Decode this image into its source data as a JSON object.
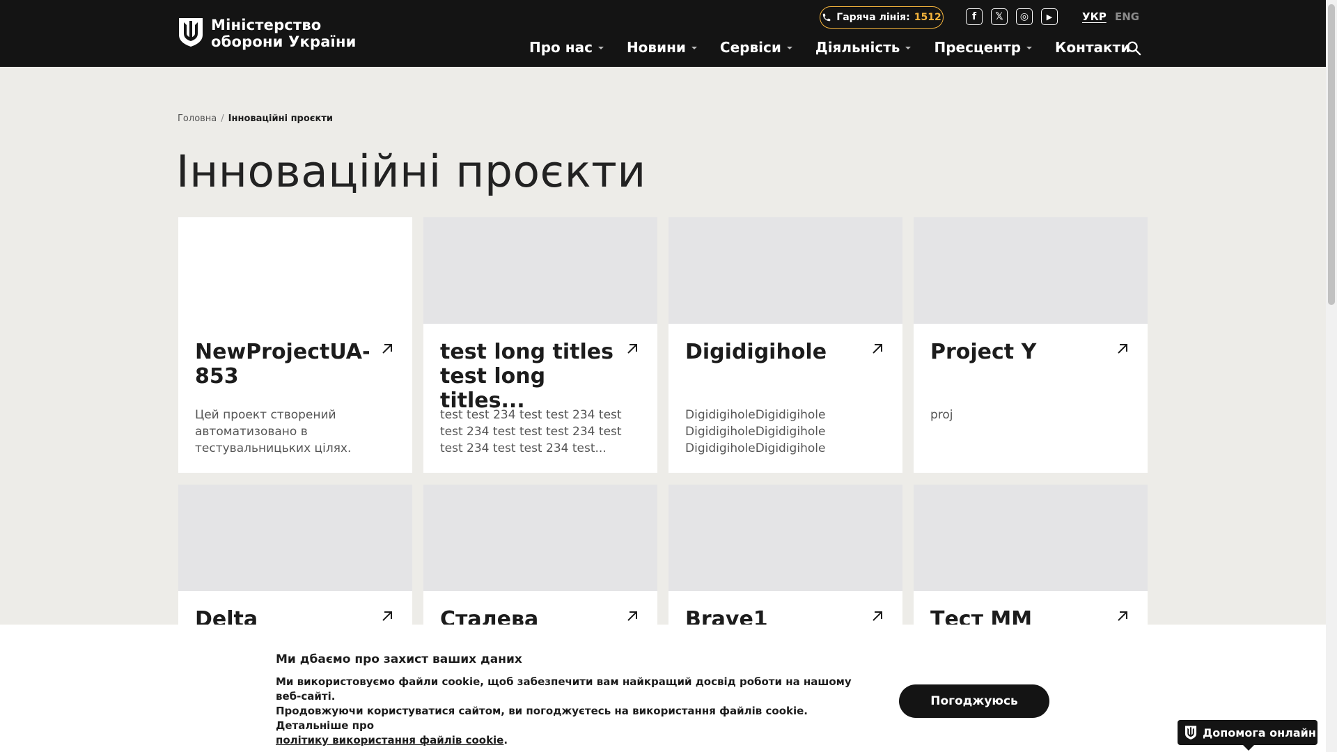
{
  "header": {
    "logo_line1": "Міністерство",
    "logo_line2": "оборони України",
    "hotline_label": "Гаряча лінія:",
    "hotline_number": "1512",
    "social": [
      {
        "name": "facebook-icon",
        "glyph": "f"
      },
      {
        "name": "x-icon",
        "glyph": "𝕏"
      },
      {
        "name": "instagram-icon",
        "glyph": "◎"
      },
      {
        "name": "youtube-icon",
        "glyph": "▶"
      }
    ],
    "lang_active": "УКР",
    "lang_inactive": "ENG",
    "nav": [
      {
        "label": "Про нас",
        "dropdown": true
      },
      {
        "label": "Новини",
        "dropdown": true
      },
      {
        "label": "Сервіси",
        "dropdown": true
      },
      {
        "label": "Діяльність",
        "dropdown": true
      },
      {
        "label": "Пресцентр",
        "dropdown": true
      },
      {
        "label": "Контакти",
        "dropdown": false
      }
    ]
  },
  "breadcrumb": {
    "home": "Головна",
    "separator": "/",
    "current": "Інноваційні проєкти"
  },
  "page_title": "Інноваційні проєкти",
  "cards": [
    {
      "title": "NewProjectUA-853",
      "desc": "Цей проект створений автоматизовано в тестувальницьких цілях.",
      "image": "blank"
    },
    {
      "title": "test long titles test long titles...",
      "desc": "test test 234 test test 234 test test 234 test test test 234 test test 234 test test 234 test...",
      "image": "placeholder"
    },
    {
      "title": "Digidigihole",
      "desc": "DigidigiholeDigidigihole DigidigiholeDigidigihole DigidigiholeDigidigihole",
      "image": "placeholder"
    },
    {
      "title": "Project Y",
      "desc": "proj",
      "image": "placeholder"
    },
    {
      "title": "Delta",
      "desc": "",
      "image": "placeholder"
    },
    {
      "title": "Сталева",
      "desc": "",
      "image": "placeholder"
    },
    {
      "title": "Brave1",
      "desc": "",
      "image": "placeholder"
    },
    {
      "title": "Тест ММ",
      "desc": "",
      "image": "placeholder"
    }
  ],
  "cookie": {
    "title": "Ми дбаємо про захист ваших даних",
    "text_line1": "Ми використовуємо файли cookie, щоб забезпечити вам найкращий досвід роботи на нашому веб-сайті.",
    "text_line2": "Продовжуючи користуватися сайтом, ви погоджуєтесь на використання файлів cookie. Детальніше про",
    "link": "політику використання файлів cookie",
    "link_suffix": ".",
    "accept": "Погоджуюсь"
  },
  "help": {
    "label": "Допомога онлайн"
  },
  "colors": {
    "header_bg": "#141414",
    "page_bg": "#edece8",
    "accent": "#f5b43c"
  }
}
